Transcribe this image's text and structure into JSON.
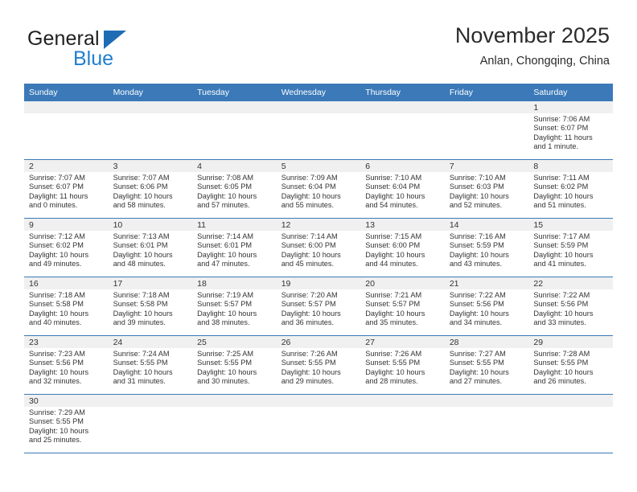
{
  "brand": {
    "name_part1": "General",
    "name_part2": "Blue",
    "triangle_icon": "triangle-icon",
    "color_dark": "#202020",
    "color_blue": "#1f7fd0"
  },
  "header": {
    "title": "November 2025",
    "subtitle": "Anlan, Chongqing, China"
  },
  "theme": {
    "header_bg": "#3b79b8",
    "daynum_bg": "#f0f0f0",
    "grid_line": "#3b79b8",
    "text": "#333333"
  },
  "weekday_headers": [
    "Sunday",
    "Monday",
    "Tuesday",
    "Wednesday",
    "Thursday",
    "Friday",
    "Saturday"
  ],
  "weeks": [
    [
      {
        "day": "",
        "empty": true
      },
      {
        "day": "",
        "empty": true
      },
      {
        "day": "",
        "empty": true
      },
      {
        "day": "",
        "empty": true
      },
      {
        "day": "",
        "empty": true
      },
      {
        "day": "",
        "empty": true
      },
      {
        "day": "1",
        "sunrise": "Sunrise: 7:06 AM",
        "sunset": "Sunset: 6:07 PM",
        "daylight_line1": "Daylight: 11 hours",
        "daylight_line2": "and 1 minute."
      }
    ],
    [
      {
        "day": "2",
        "sunrise": "Sunrise: 7:07 AM",
        "sunset": "Sunset: 6:07 PM",
        "daylight_line1": "Daylight: 11 hours",
        "daylight_line2": "and 0 minutes."
      },
      {
        "day": "3",
        "sunrise": "Sunrise: 7:07 AM",
        "sunset": "Sunset: 6:06 PM",
        "daylight_line1": "Daylight: 10 hours",
        "daylight_line2": "and 58 minutes."
      },
      {
        "day": "4",
        "sunrise": "Sunrise: 7:08 AM",
        "sunset": "Sunset: 6:05 PM",
        "daylight_line1": "Daylight: 10 hours",
        "daylight_line2": "and 57 minutes."
      },
      {
        "day": "5",
        "sunrise": "Sunrise: 7:09 AM",
        "sunset": "Sunset: 6:04 PM",
        "daylight_line1": "Daylight: 10 hours",
        "daylight_line2": "and 55 minutes."
      },
      {
        "day": "6",
        "sunrise": "Sunrise: 7:10 AM",
        "sunset": "Sunset: 6:04 PM",
        "daylight_line1": "Daylight: 10 hours",
        "daylight_line2": "and 54 minutes."
      },
      {
        "day": "7",
        "sunrise": "Sunrise: 7:10 AM",
        "sunset": "Sunset: 6:03 PM",
        "daylight_line1": "Daylight: 10 hours",
        "daylight_line2": "and 52 minutes."
      },
      {
        "day": "8",
        "sunrise": "Sunrise: 7:11 AM",
        "sunset": "Sunset: 6:02 PM",
        "daylight_line1": "Daylight: 10 hours",
        "daylight_line2": "and 51 minutes."
      }
    ],
    [
      {
        "day": "9",
        "sunrise": "Sunrise: 7:12 AM",
        "sunset": "Sunset: 6:02 PM",
        "daylight_line1": "Daylight: 10 hours",
        "daylight_line2": "and 49 minutes."
      },
      {
        "day": "10",
        "sunrise": "Sunrise: 7:13 AM",
        "sunset": "Sunset: 6:01 PM",
        "daylight_line1": "Daylight: 10 hours",
        "daylight_line2": "and 48 minutes."
      },
      {
        "day": "11",
        "sunrise": "Sunrise: 7:14 AM",
        "sunset": "Sunset: 6:01 PM",
        "daylight_line1": "Daylight: 10 hours",
        "daylight_line2": "and 47 minutes."
      },
      {
        "day": "12",
        "sunrise": "Sunrise: 7:14 AM",
        "sunset": "Sunset: 6:00 PM",
        "daylight_line1": "Daylight: 10 hours",
        "daylight_line2": "and 45 minutes."
      },
      {
        "day": "13",
        "sunrise": "Sunrise: 7:15 AM",
        "sunset": "Sunset: 6:00 PM",
        "daylight_line1": "Daylight: 10 hours",
        "daylight_line2": "and 44 minutes."
      },
      {
        "day": "14",
        "sunrise": "Sunrise: 7:16 AM",
        "sunset": "Sunset: 5:59 PM",
        "daylight_line1": "Daylight: 10 hours",
        "daylight_line2": "and 43 minutes."
      },
      {
        "day": "15",
        "sunrise": "Sunrise: 7:17 AM",
        "sunset": "Sunset: 5:59 PM",
        "daylight_line1": "Daylight: 10 hours",
        "daylight_line2": "and 41 minutes."
      }
    ],
    [
      {
        "day": "16",
        "sunrise": "Sunrise: 7:18 AM",
        "sunset": "Sunset: 5:58 PM",
        "daylight_line1": "Daylight: 10 hours",
        "daylight_line2": "and 40 minutes."
      },
      {
        "day": "17",
        "sunrise": "Sunrise: 7:18 AM",
        "sunset": "Sunset: 5:58 PM",
        "daylight_line1": "Daylight: 10 hours",
        "daylight_line2": "and 39 minutes."
      },
      {
        "day": "18",
        "sunrise": "Sunrise: 7:19 AM",
        "sunset": "Sunset: 5:57 PM",
        "daylight_line1": "Daylight: 10 hours",
        "daylight_line2": "and 38 minutes."
      },
      {
        "day": "19",
        "sunrise": "Sunrise: 7:20 AM",
        "sunset": "Sunset: 5:57 PM",
        "daylight_line1": "Daylight: 10 hours",
        "daylight_line2": "and 36 minutes."
      },
      {
        "day": "20",
        "sunrise": "Sunrise: 7:21 AM",
        "sunset": "Sunset: 5:57 PM",
        "daylight_line1": "Daylight: 10 hours",
        "daylight_line2": "and 35 minutes."
      },
      {
        "day": "21",
        "sunrise": "Sunrise: 7:22 AM",
        "sunset": "Sunset: 5:56 PM",
        "daylight_line1": "Daylight: 10 hours",
        "daylight_line2": "and 34 minutes."
      },
      {
        "day": "22",
        "sunrise": "Sunrise: 7:22 AM",
        "sunset": "Sunset: 5:56 PM",
        "daylight_line1": "Daylight: 10 hours",
        "daylight_line2": "and 33 minutes."
      }
    ],
    [
      {
        "day": "23",
        "sunrise": "Sunrise: 7:23 AM",
        "sunset": "Sunset: 5:56 PM",
        "daylight_line1": "Daylight: 10 hours",
        "daylight_line2": "and 32 minutes."
      },
      {
        "day": "24",
        "sunrise": "Sunrise: 7:24 AM",
        "sunset": "Sunset: 5:55 PM",
        "daylight_line1": "Daylight: 10 hours",
        "daylight_line2": "and 31 minutes."
      },
      {
        "day": "25",
        "sunrise": "Sunrise: 7:25 AM",
        "sunset": "Sunset: 5:55 PM",
        "daylight_line1": "Daylight: 10 hours",
        "daylight_line2": "and 30 minutes."
      },
      {
        "day": "26",
        "sunrise": "Sunrise: 7:26 AM",
        "sunset": "Sunset: 5:55 PM",
        "daylight_line1": "Daylight: 10 hours",
        "daylight_line2": "and 29 minutes."
      },
      {
        "day": "27",
        "sunrise": "Sunrise: 7:26 AM",
        "sunset": "Sunset: 5:55 PM",
        "daylight_line1": "Daylight: 10 hours",
        "daylight_line2": "and 28 minutes."
      },
      {
        "day": "28",
        "sunrise": "Sunrise: 7:27 AM",
        "sunset": "Sunset: 5:55 PM",
        "daylight_line1": "Daylight: 10 hours",
        "daylight_line2": "and 27 minutes."
      },
      {
        "day": "29",
        "sunrise": "Sunrise: 7:28 AM",
        "sunset": "Sunset: 5:55 PM",
        "daylight_line1": "Daylight: 10 hours",
        "daylight_line2": "and 26 minutes."
      }
    ],
    [
      {
        "day": "30",
        "sunrise": "Sunrise: 7:29 AM",
        "sunset": "Sunset: 5:55 PM",
        "daylight_line1": "Daylight: 10 hours",
        "daylight_line2": "and 25 minutes."
      },
      {
        "day": "",
        "empty": true
      },
      {
        "day": "",
        "empty": true
      },
      {
        "day": "",
        "empty": true
      },
      {
        "day": "",
        "empty": true
      },
      {
        "day": "",
        "empty": true
      },
      {
        "day": "",
        "empty": true
      }
    ]
  ]
}
